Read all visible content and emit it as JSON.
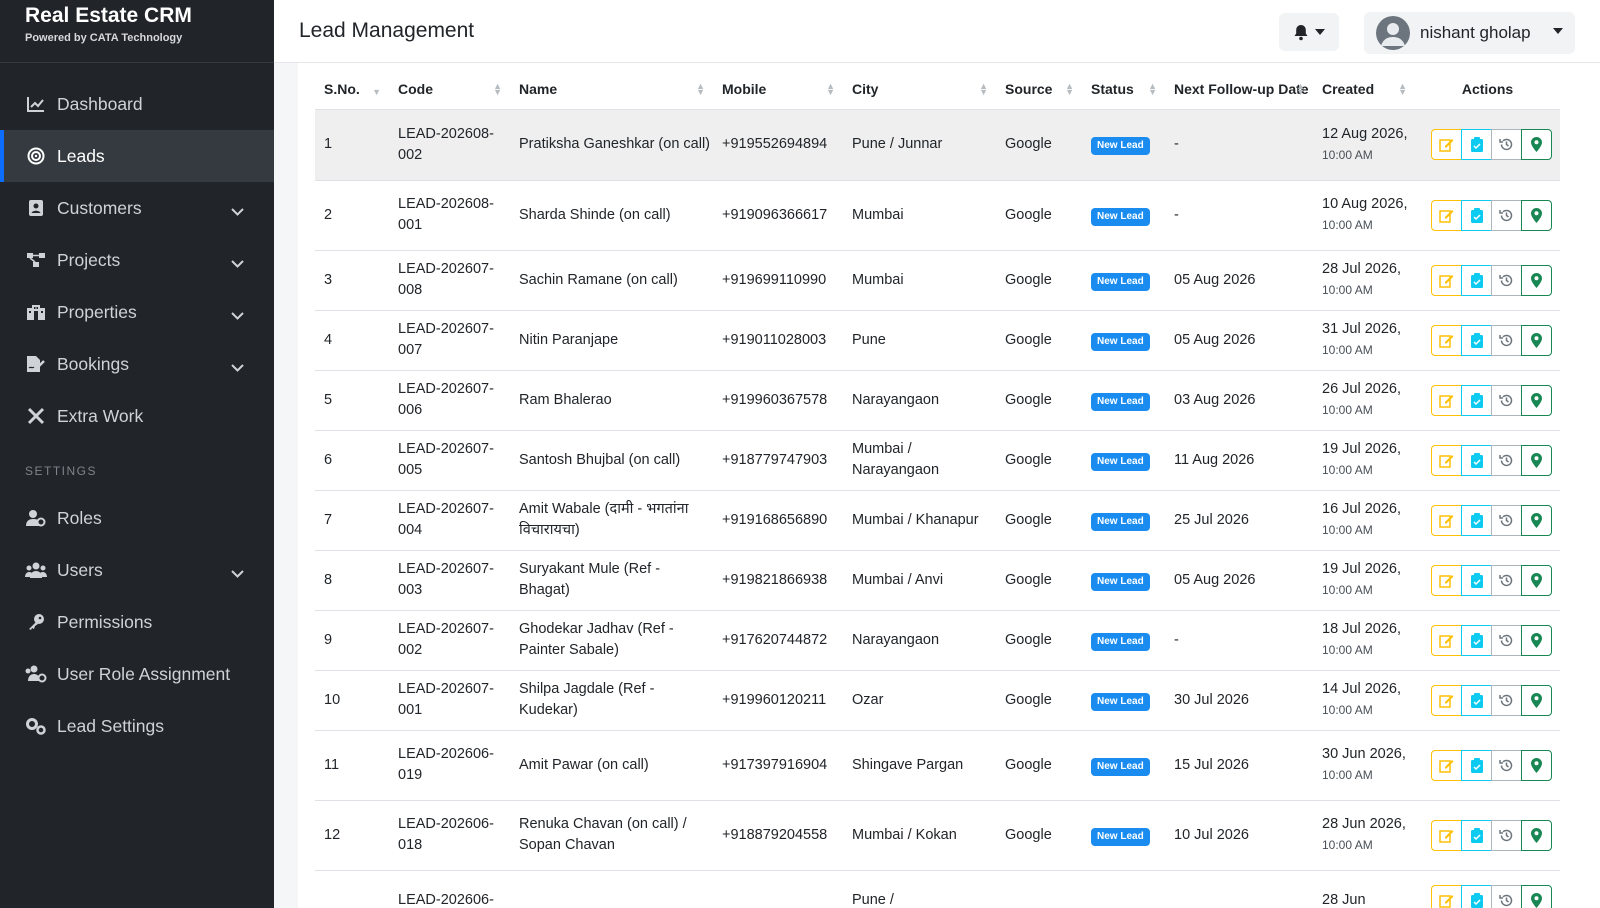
{
  "brand": {
    "title": "Real Estate CRM",
    "subtitle": "Powered by CATA Technology"
  },
  "sidebar": {
    "items": [
      {
        "label": "Dashboard",
        "icon": "chart-line-icon",
        "active": false,
        "expandable": false
      },
      {
        "label": "Leads",
        "icon": "target-icon",
        "active": true,
        "expandable": false
      },
      {
        "label": "Customers",
        "icon": "contact-card-icon",
        "active": false,
        "expandable": true
      },
      {
        "label": "Projects",
        "icon": "project-diagram-icon",
        "active": false,
        "expandable": true
      },
      {
        "label": "Properties",
        "icon": "building-icon",
        "active": false,
        "expandable": true
      },
      {
        "label": "Bookings",
        "icon": "file-signature-icon",
        "active": false,
        "expandable": true
      },
      {
        "label": "Extra Work",
        "icon": "tools-icon",
        "active": false,
        "expandable": false
      }
    ],
    "settings_heading": "SETTINGS",
    "settings_items": [
      {
        "label": "Roles",
        "icon": "user-gear-icon",
        "expandable": false
      },
      {
        "label": "Users",
        "icon": "users-icon",
        "expandable": true
      },
      {
        "label": "Permissions",
        "icon": "key-icon",
        "expandable": false
      },
      {
        "label": "User Role Assignment",
        "icon": "users-cog-icon",
        "expandable": false
      },
      {
        "label": "Lead Settings",
        "icon": "cogs-icon",
        "expandable": false
      }
    ]
  },
  "header": {
    "title": "Lead Management",
    "user_name": "nishant gholap"
  },
  "table": {
    "columns": [
      "S.No.",
      "Code",
      "Name",
      "Mobile",
      "City",
      "Source",
      "Status",
      "Next Follow-up Date",
      "Created",
      "Actions"
    ],
    "rows": [
      {
        "sno": "1",
        "code": "LEAD-202608-002",
        "name": "Pratiksha Ganeshkar (on call)",
        "mobile": "+919552694894",
        "city": "Pune / Junnar",
        "source": "Google",
        "status": "New Lead",
        "followup": "-",
        "created_date": "12 Aug 2026,",
        "created_time": "10:00 AM"
      },
      {
        "sno": "2",
        "code": "LEAD-202608-001",
        "name": "Sharda Shinde (on call)",
        "mobile": "+919096366617",
        "city": "Mumbai",
        "source": "Google",
        "status": "New Lead",
        "followup": "-",
        "created_date": "10 Aug 2026,",
        "created_time": "10:00 AM"
      },
      {
        "sno": "3",
        "code": "LEAD-202607-008",
        "name": "Sachin Ramane (on call)",
        "mobile": "+919699110990",
        "city": "Mumbai",
        "source": "Google",
        "status": "New Lead",
        "followup": "05 Aug 2026",
        "created_date": "28 Jul 2026,",
        "created_time": "10:00 AM"
      },
      {
        "sno": "4",
        "code": "LEAD-202607-007",
        "name": "Nitin Paranjape",
        "mobile": "+919011028003",
        "city": "Pune",
        "source": "Google",
        "status": "New Lead",
        "followup": "05 Aug 2026",
        "created_date": "31 Jul 2026,",
        "created_time": "10:00 AM"
      },
      {
        "sno": "5",
        "code": "LEAD-202607-006",
        "name": "Ram Bhalerao",
        "mobile": "+919960367578",
        "city": "Narayangaon",
        "source": "Google",
        "status": "New Lead",
        "followup": "03 Aug 2026",
        "created_date": "26 Jul 2026,",
        "created_time": "10:00 AM"
      },
      {
        "sno": "6",
        "code": "LEAD-202607-005",
        "name": "Santosh Bhujbal (on call)",
        "mobile": "+918779747903",
        "city": "Mumbai / Narayangaon",
        "source": "Google",
        "status": "New Lead",
        "followup": "11 Aug 2026",
        "created_date": "19 Jul 2026,",
        "created_time": "10:00 AM"
      },
      {
        "sno": "7",
        "code": "LEAD-202607-004",
        "name": "Amit Wabale (दामी - भगतांना विचारायचा)",
        "mobile": "+919168656890",
        "city": "Mumbai / Khanapur",
        "source": "Google",
        "status": "New Lead",
        "followup": "25 Jul 2026",
        "created_date": "16 Jul 2026,",
        "created_time": "10:00 AM"
      },
      {
        "sno": "8",
        "code": "LEAD-202607-003",
        "name": "Suryakant Mule (Ref - Bhagat)",
        "mobile": "+919821866938",
        "city": "Mumbai / Anvi",
        "source": "Google",
        "status": "New Lead",
        "followup": "05 Aug 2026",
        "created_date": "19 Jul 2026,",
        "created_time": "10:00 AM"
      },
      {
        "sno": "9",
        "code": "LEAD-202607-002",
        "name": "Ghodekar Jadhav (Ref - Painter Sabale)",
        "mobile": "+917620744872",
        "city": "Narayangaon",
        "source": "Google",
        "status": "New Lead",
        "followup": "-",
        "created_date": "18 Jul 2026,",
        "created_time": "10:00 AM"
      },
      {
        "sno": "10",
        "code": "LEAD-202607-001",
        "name": "Shilpa Jagdale (Ref - Kudekar)",
        "mobile": "+919960120211",
        "city": "Ozar",
        "source": "Google",
        "status": "New Lead",
        "followup": "30 Jul 2026",
        "created_date": "14 Jul 2026,",
        "created_time": "10:00 AM"
      },
      {
        "sno": "11",
        "code": "LEAD-202606-019",
        "name": "Amit Pawar (on call)",
        "mobile": "+917397916904",
        "city": "Shingave Pargan",
        "source": "Google",
        "status": "New Lead",
        "followup": "15 Jul 2026",
        "created_date": "30 Jun 2026,",
        "created_time": "10:00 AM"
      },
      {
        "sno": "12",
        "code": "LEAD-202606-018",
        "name": "Renuka Chavan (on call) / Sopan Chavan",
        "mobile": "+918879204558",
        "city": "Mumbai / Kokan",
        "source": "Google",
        "status": "New Lead",
        "followup": "10 Jul 2026",
        "created_date": "28 Jun 2026,",
        "created_time": "10:00 AM"
      },
      {
        "sno": "",
        "code": "LEAD-202606-",
        "name": "",
        "mobile": "",
        "city": "Pune /",
        "source": "",
        "status": "",
        "followup": "",
        "created_date": "28 Jun",
        "created_time": ""
      }
    ]
  },
  "colors": {
    "sidebar_bg": "#212529",
    "accent": "#0d6efd",
    "badge": "#1a8cf0",
    "edit": "#ffc107",
    "clip": "#0dcaf0",
    "history": "#6c757d",
    "pin": "#198754"
  }
}
